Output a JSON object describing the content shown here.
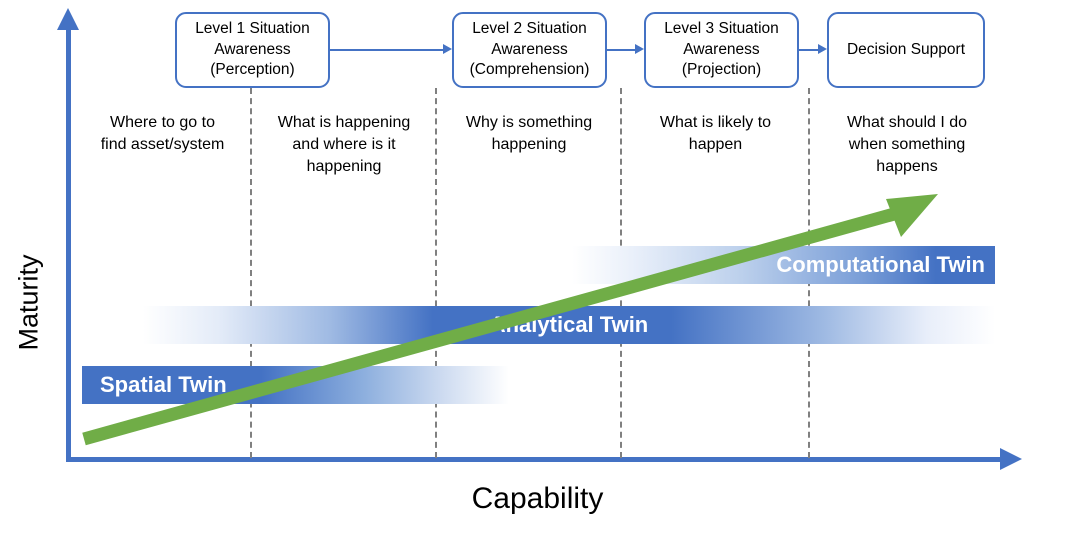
{
  "axes": {
    "y_label": "Maturity",
    "x_label": "Capability",
    "axis_color": "#4472C4"
  },
  "colors": {
    "accent_blue": "#4472C4",
    "arrow_green": "#70AD47",
    "divider_gray": "#808080",
    "text_black": "#000000"
  },
  "chart_data": {
    "type": "diagram",
    "title": "",
    "xlabel": "Capability",
    "ylabel": "Maturity",
    "stages": [
      {
        "label": "Where to go to find asset/system"
      },
      {
        "label": "Level 1 Situation Awareness (Perception)"
      },
      {
        "label": "Level 2 Situation Awareness (Comprehension)"
      },
      {
        "label": "Level 3 Situation Awareness (Projection)"
      },
      {
        "label": "Decision Support"
      }
    ],
    "series": [
      {
        "name": "Spatial Twin",
        "x_start": 0.0,
        "x_end": 0.47,
        "y": 0.26
      },
      {
        "name": "Analytical Twin",
        "x_start": 0.08,
        "x_end": 0.99,
        "y": 0.4
      },
      {
        "name": "Computational Twin",
        "x_start": 0.54,
        "x_end": 0.99,
        "y": 0.54
      }
    ],
    "trend_arrow": {
      "name": "maturity-capability-trend",
      "from": [
        0.02,
        0.05
      ],
      "to": [
        0.93,
        0.62
      ]
    }
  },
  "flow": {
    "boxes": [
      {
        "id": "level1",
        "lines": [
          "Level 1 Situation",
          "Awareness",
          "(Perception)"
        ]
      },
      {
        "id": "level2",
        "lines": [
          "Level 2 Situation",
          "Awareness",
          "(Comprehension)"
        ]
      },
      {
        "id": "level3",
        "lines": [
          "Level 3 Situation",
          "Awareness",
          "(Projection)"
        ]
      },
      {
        "id": "decision",
        "lines": [
          "Decision Support"
        ]
      }
    ],
    "box_text": {
      "level1": "Level 1 Situation\nAwareness\n(Perception)",
      "level2": "Level 2 Situation\nAwareness\n(Comprehension)",
      "level3": "Level 3 Situation\nAwareness\n(Projection)",
      "decision": "Decision Support"
    }
  },
  "captions": {
    "col1": "Where to go to\nfind asset/system",
    "col2": "What is happening\nand where is it\nhappening",
    "col3": "Why is something\nhappening",
    "col4": "What is likely to\nhappen",
    "col5": "What should I do\nwhen something\nhappens"
  },
  "bars": {
    "computational": {
      "label": "Computational Twin"
    },
    "analytical": {
      "label": "Analytical Twin"
    },
    "spatial": {
      "label": "Spatial Twin"
    }
  }
}
